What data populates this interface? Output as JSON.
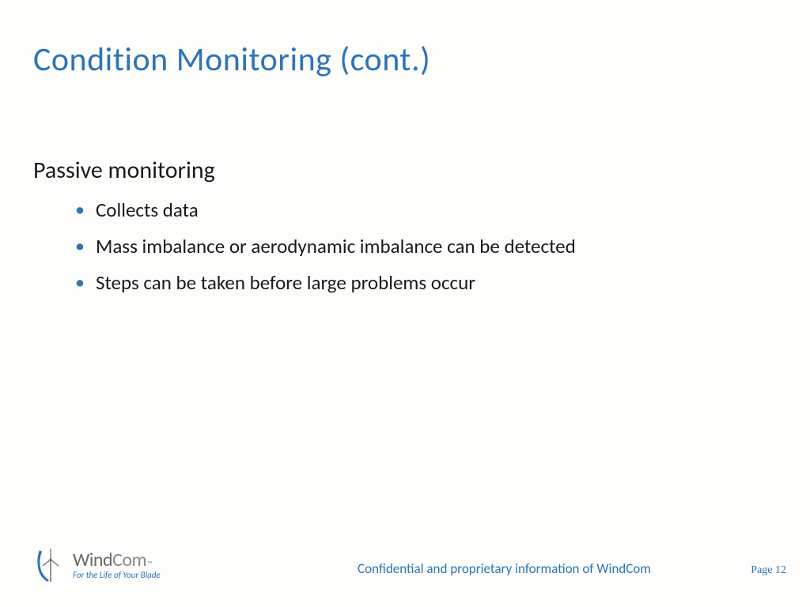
{
  "title": "Condition Monitoring (cont.)",
  "section_heading": "Passive monitoring",
  "bullets": [
    "Collects data",
    "Mass imbalance or aerodynamic imbalance can be detected",
    "Steps can be taken before large problems occur"
  ],
  "logo": {
    "part1": "Wind",
    "part2": "Com",
    "tm": "™",
    "tagline": "For the Life of Your Blade"
  },
  "footer": {
    "confidential": "Confidential and proprietary information of WindCom",
    "page": "Page 12"
  },
  "colors": {
    "accent": "#2e74b5",
    "text": "#1a1a1a",
    "logo_gray": "#6b6b6b"
  }
}
